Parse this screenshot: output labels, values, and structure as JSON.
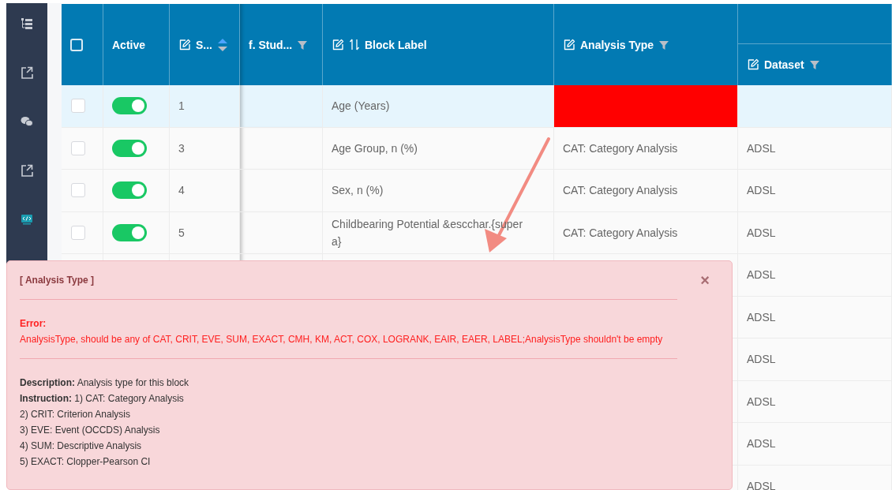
{
  "sidebar": {
    "items": [
      {
        "kind": "tree"
      },
      {
        "kind": "external"
      },
      {
        "kind": "chat"
      },
      {
        "kind": "external"
      },
      {
        "kind": "code"
      }
    ]
  },
  "table": {
    "columns": [
      {
        "kind": "checkbox",
        "checked": false
      },
      {
        "kind": "text",
        "label": "Active"
      },
      {
        "kind": "text",
        "label": "S...",
        "edit": true,
        "sorted_ascending": true
      },
      {
        "kind": "text",
        "label": "f. Stud...",
        "filter": true
      },
      {
        "kind": "text",
        "label": "Block Label",
        "edit": true,
        "sort_arrows": true
      },
      {
        "kind": "text",
        "label": "Analysis Type",
        "edit": true,
        "filter": true
      },
      {
        "kind": "grouped",
        "label": "Dataset",
        "edit": true,
        "filter": true
      }
    ],
    "rows": [
      {
        "selected": true,
        "checked": false,
        "active": true,
        "seq": "1",
        "block_label": "Age (Years)",
        "analysis_type_error": true,
        "dataset": ""
      },
      {
        "selected": false,
        "checked": false,
        "active": true,
        "seq": "3",
        "block_label": "Age Group, n (%)",
        "analysis_type": "CAT: Category Analysis",
        "dataset": "ADSL"
      },
      {
        "selected": false,
        "checked": false,
        "active": true,
        "seq": "4",
        "block_label": "Sex, n (%)",
        "analysis_type": "CAT: Category Analysis",
        "dataset": "ADSL"
      },
      {
        "selected": false,
        "checked": false,
        "active": true,
        "seq": "5",
        "block_label": "Childbearing Potential &escchar.{super a}",
        "analysis_type": "CAT: Category Analysis",
        "dataset": "ADSL"
      },
      {
        "selected": false,
        "dataset": "ADSL"
      },
      {
        "selected": false,
        "dataset": "ADSL"
      },
      {
        "selected": false,
        "dataset": "ADSL"
      },
      {
        "selected": false,
        "dataset": "ADSL"
      },
      {
        "selected": false,
        "dataset": "ADSL"
      },
      {
        "selected": false,
        "dataset": "ADSL"
      }
    ]
  },
  "popup": {
    "title": "[ Analysis Type ]",
    "close": "×",
    "error_label": "Error:",
    "error_message": "AnalysisType, should be any of CAT, CRIT, EVE, SUM, EXACT, CMH, KM, ACT, COX, LOGRANK, EAIR, EAER, LABEL;AnalysisType shouldn't be empty",
    "lines": [
      "**Description:** Analysis type for this block",
      "**Instruction:** 1) CAT: Category Analysis",
      "2) CRIT: Criterion Analysis",
      "3) EVE: Event (OCCDS) Analysis",
      "4) SUM: Descriptive Analysis",
      "5) EXACT: Clopper-Pearson CI"
    ]
  }
}
